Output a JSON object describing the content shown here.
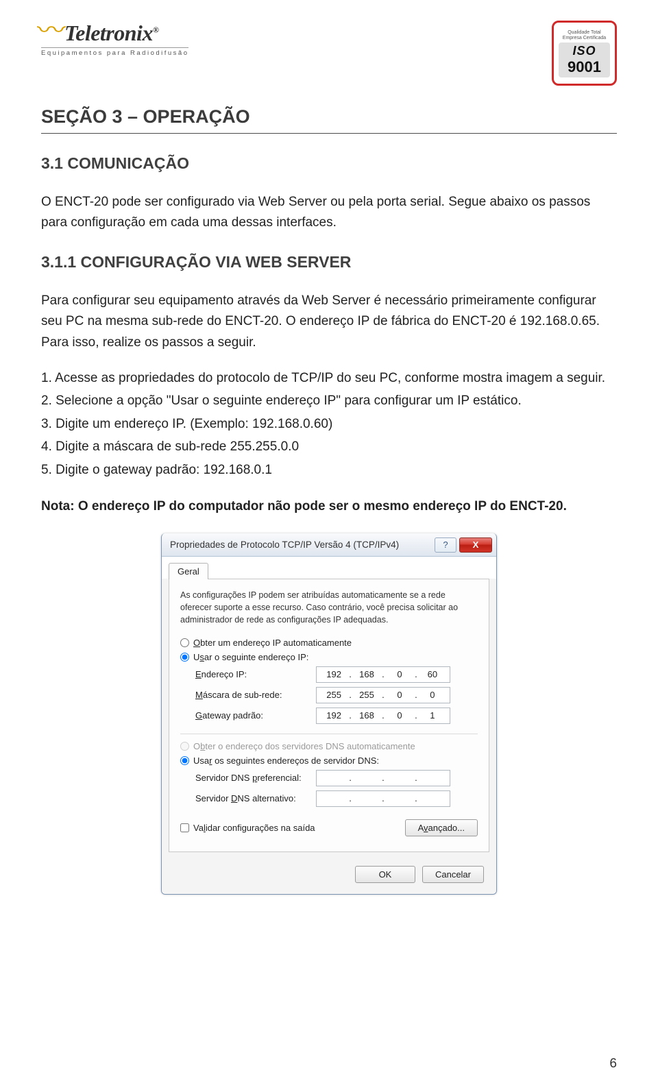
{
  "logo": {
    "brand": "Teletronix",
    "registered": "®",
    "tagline": "Equipamentos para Radiodifusão"
  },
  "iso": {
    "top1": "Qualidade Total",
    "top2": "Empresa Certificada",
    "label": "ISO",
    "number": "9001"
  },
  "section_title": "SEÇÃO 3 – OPERAÇÃO",
  "sub1": "3.1 COMUNICAÇÃO",
  "para1": "O ENCT-20 pode ser configurado via Web Server ou pela porta serial. Segue abaixo os passos para configuração em cada uma dessas interfaces.",
  "sub2": "3.1.1 CONFIGURAÇÃO VIA WEB SERVER",
  "para2": "Para configurar seu equipamento através da Web Server é necessário primeiramente configurar seu PC na mesma sub-rede do ENCT-20. O endereço IP de fábrica do ENCT-20 é 192.168.0.65. Para isso, realize os passos a seguir.",
  "steps": {
    "s1": "1. Acesse as propriedades do protocolo de TCP/IP do seu PC, conforme mostra imagem a seguir.",
    "s2": "2. Selecione a opção \"Usar o seguinte endereço IP\" para configurar um IP estático.",
    "s3": "3. Digite um endereço IP. (Exemplo: 192.168.0.60)",
    "s4": "4. Digite a máscara de sub-rede 255.255.0.0",
    "s5": "5. Digite o gateway padrão: 192.168.0.1"
  },
  "note": "Nota: O endereço IP do computador não pode ser o mesmo endereço IP do ENCT-20.",
  "dialog": {
    "title": "Propriedades de Protocolo TCP/IP Versão 4 (TCP/IPv4)",
    "help": "?",
    "close_x": "X",
    "tab_general": "Geral",
    "desc": "As configurações IP podem ser atribuídas automaticamente se a rede oferecer suporte a esse recurso. Caso contrário, você precisa solicitar ao administrador de rede as configurações IP adequadas.",
    "radio_auto_ip": "Obter um endereço IP automaticamente",
    "radio_use_ip": "Usar o seguinte endereço IP:",
    "lbl_ip": "Endereço IP:",
    "lbl_mask": "Máscara de sub-rede:",
    "lbl_gateway": "Gateway padrão:",
    "radio_auto_dns": "Obter o endereço dos servidores DNS automaticamente",
    "radio_use_dns": "Usar os seguintes endereços de servidor DNS:",
    "lbl_dns_pref": "Servidor DNS preferencial:",
    "lbl_dns_alt": "Servidor DNS alternativo:",
    "chk_validate": "Validar configurações na saída",
    "btn_advanced": "Avançado...",
    "btn_ok": "OK",
    "btn_cancel": "Cancelar",
    "ip": {
      "a": "192",
      "b": "168",
      "c": "0",
      "d": "60"
    },
    "mask": {
      "a": "255",
      "b": "255",
      "c": "0",
      "d": "0"
    },
    "gw": {
      "a": "192",
      "b": "168",
      "c": "0",
      "d": "1"
    }
  },
  "page_number": "6"
}
